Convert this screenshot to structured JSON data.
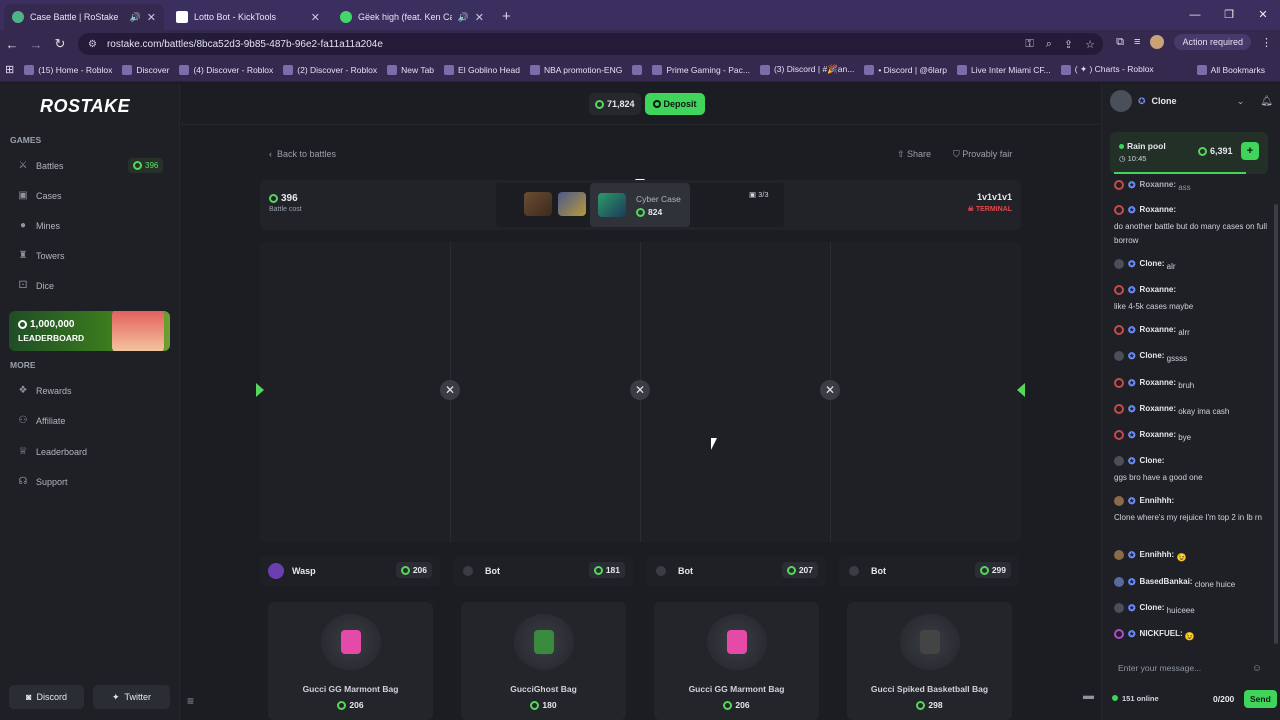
{
  "browser": {
    "tabs": [
      {
        "title": "Case Battle | RoStake",
        "color": "#4fb387"
      },
      {
        "title": "Lotto Bot - KickTools",
        "color": "#ffffff"
      },
      {
        "title": "Gëek high (feat. Ken Carson)",
        "color": "#43d66b"
      }
    ],
    "url": "rostake.com/battles/8bca52d3-9b85-487b-96e2-fa11a11a204e",
    "action_label": "Action required",
    "bookmarks": [
      "(15) Home - Roblox",
      "Discover",
      "(4) Discover - Roblox",
      "(2) Discover - Roblox",
      "New Tab",
      "El Goblino Head",
      "NBA promotion-ENG",
      "Prime Gaming - Pac...",
      "(3) Discord | #🎉an...",
      "• Discord | @6larp",
      "Live Inter Miami CF...",
      "( ✦ ) Charts - Roblox"
    ],
    "all_bookmarks": "All Bookmarks"
  },
  "sidebar": {
    "logo": "ROSTAKE",
    "games_label": "GAMES",
    "games": [
      "Battles",
      "Cases",
      "Mines",
      "Towers",
      "Dice"
    ],
    "battles_badge": "396",
    "leaderboard": {
      "amount": "1,000,000",
      "label": "LEADERBOARD"
    },
    "more_label": "MORE",
    "more": [
      "Rewards",
      "Affiliate",
      "Leaderboard",
      "Support"
    ],
    "discord": "Discord",
    "twitter": "Twitter"
  },
  "header": {
    "balance": "71,824",
    "deposit": "Deposit"
  },
  "battle": {
    "back": "Back to battles",
    "share": "Share",
    "fair": "Provably fair",
    "cost": "396",
    "cost_label": "Battle cost",
    "case_name": "Cyber Case",
    "case_price": "824",
    "count": "3/3",
    "mode": "1v1v1v1",
    "status": "TERMINAL",
    "players": [
      {
        "name": "Wasp",
        "value": "206"
      },
      {
        "name": "Bot",
        "value": "181"
      },
      {
        "name": "Bot",
        "value": "207"
      },
      {
        "name": "Bot",
        "value": "299"
      }
    ],
    "items": [
      {
        "name": "Gucci GG Marmont Bag",
        "value": "206",
        "color": "#e54aa9"
      },
      {
        "name": "GucciGhost Bag",
        "value": "180",
        "color": "#3a8a3e"
      },
      {
        "name": "Gucci GG Marmont Bag",
        "value": "206",
        "color": "#e54aa9"
      },
      {
        "name": "Gucci Spiked Basketball Bag",
        "value": "298",
        "color": "#444"
      }
    ]
  },
  "chat": {
    "user": "Clone",
    "rain": {
      "label": "Rain pool",
      "time": "10:45",
      "amount": "6,391"
    },
    "messages": [
      {
        "user": "Roxanne:",
        "text": "ass"
      },
      {
        "user": "Roxanne:",
        "text": "do another battle but do many cases on full borrow"
      },
      {
        "user": "Clone:",
        "text": "alr"
      },
      {
        "user": "Roxanne:",
        "text": "like 4-5k cases maybe"
      },
      {
        "user": "Roxanne:",
        "text": "alrr"
      },
      {
        "user": "Clone:",
        "text": "gssss"
      },
      {
        "user": "Roxanne:",
        "text": "bruh"
      },
      {
        "user": "Roxanne:",
        "text": "okay ima cash"
      },
      {
        "user": "Roxanne:",
        "text": "bye"
      },
      {
        "user": "Clone:",
        "text": "ggs bro have a good one"
      },
      {
        "user": "Ennihhh:",
        "text": "Clone where's my rejuice I'm top 2 in lb rn"
      },
      {
        "user": "Ennihhh:",
        "text": "😉"
      },
      {
        "user": "BasedBankai:",
        "text": "clone huice"
      },
      {
        "user": "Clone:",
        "text": "huiceee"
      },
      {
        "user": "NICKFUEL:",
        "text": "😉"
      }
    ],
    "placeholder": "Enter your message...",
    "online": "151 online",
    "count": "0/200",
    "send": "Send"
  }
}
